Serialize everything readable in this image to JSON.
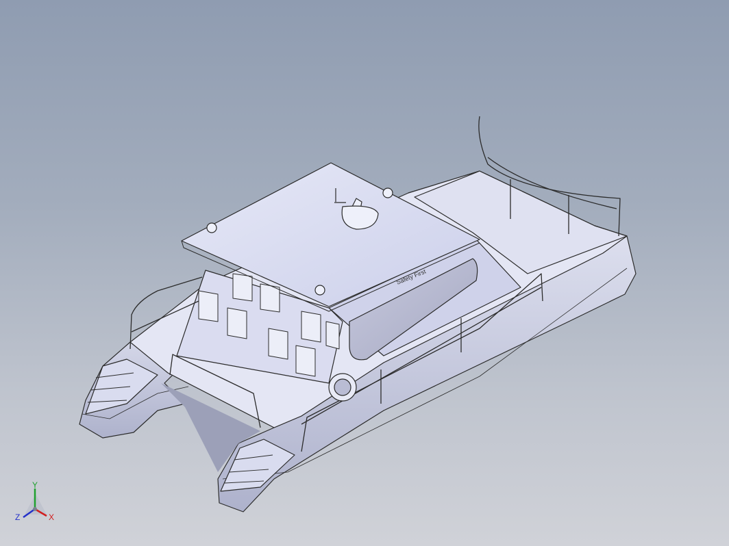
{
  "viewport": {
    "background_top": "#8f9cb1",
    "background_bottom": "#d0d2d8"
  },
  "model": {
    "type": "catamaran-assembly",
    "cabin_lettering": "Safety First",
    "hull_color": "#dcdff0",
    "edge_color": "#2b2b2b"
  },
  "triad": {
    "x_label": "X",
    "y_label": "Y",
    "z_label": "Z",
    "x_color": "#d11f1f",
    "y_color": "#1fa12e",
    "z_color": "#2330c9"
  }
}
